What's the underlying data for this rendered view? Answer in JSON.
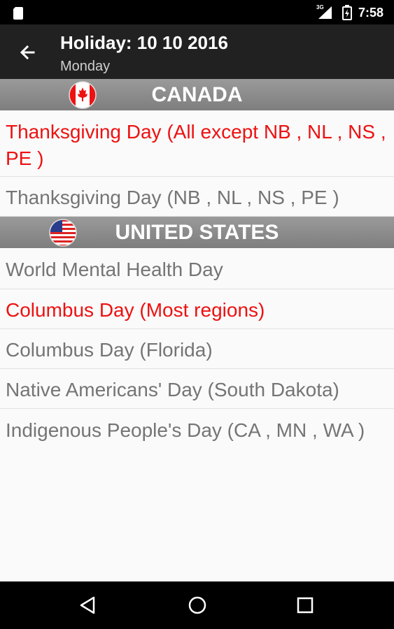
{
  "status_bar": {
    "network": "3G",
    "time": "7:58",
    "icons": [
      "sd-card-icon",
      "signal-icon",
      "battery-charging-icon"
    ]
  },
  "app_bar": {
    "title": "Holiday: 10 10 2016",
    "subtitle": "Monday",
    "back_icon": "arrow-left-icon"
  },
  "sections": [
    {
      "country": "CANADA",
      "flag_icon": "canada-flag-icon",
      "holidays": [
        {
          "name": "Thanksgiving Day (All except NB , NL , NS , PE )",
          "color": "#ee1111"
        },
        {
          "name": "Thanksgiving Day (NB , NL , NS , PE )",
          "color": "#757575"
        }
      ]
    },
    {
      "country": "UNITED STATES",
      "flag_icon": "usa-flag-icon",
      "holidays": [
        {
          "name": "World Mental Health Day",
          "color": "#757575"
        },
        {
          "name": "Columbus Day (Most regions)",
          "color": "#ee1111"
        },
        {
          "name": "Columbus Day (Florida)",
          "color": "#757575"
        },
        {
          "name": "Native Americans' Day (South Dakota)",
          "color": "#757575"
        },
        {
          "name": "Indigenous People's Day (CA , MN , WA )",
          "color": "#757575"
        }
      ]
    }
  ],
  "nav_bar": {
    "icons": [
      "back-triangle-icon",
      "home-circle-icon",
      "recents-square-icon"
    ]
  },
  "colors": {
    "status_bar": "#000000",
    "app_bar": "#212121",
    "section_header": "#8a8a8a",
    "highlight_text": "#ee1111",
    "normal_text": "#757575",
    "background": "#fafafa"
  }
}
